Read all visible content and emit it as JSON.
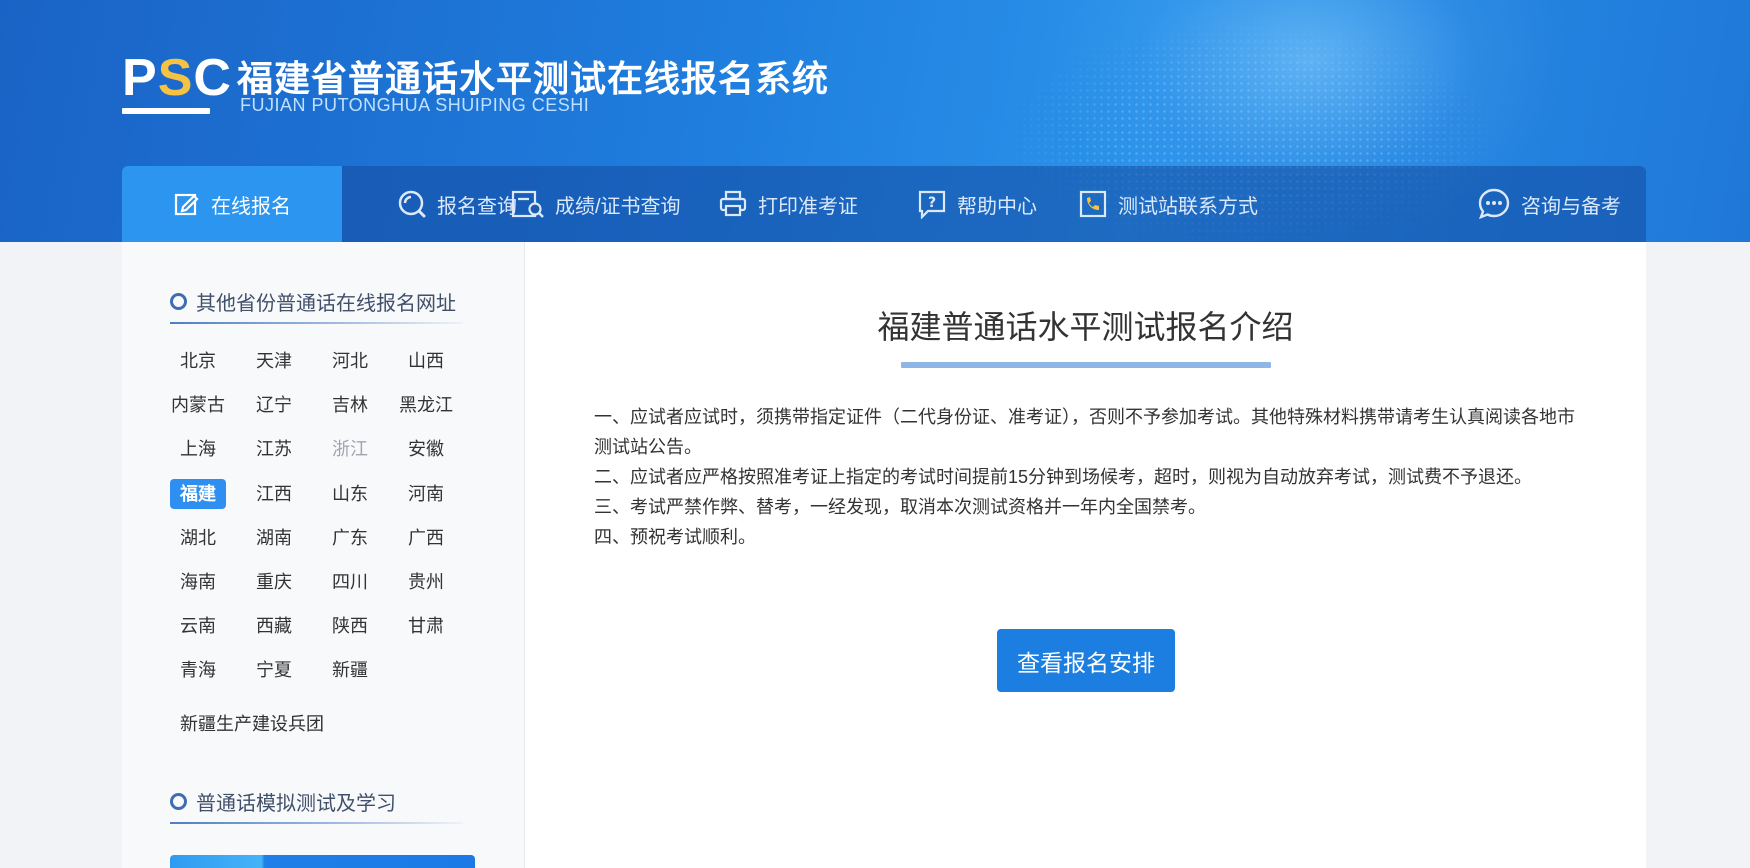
{
  "header": {
    "logo": {
      "p": "P",
      "s": "S",
      "c": "C"
    },
    "title": "福建省普通话水平测试在线报名系统",
    "subtitle": "FUJIAN PUTONGHUA SHUIPING CESHI"
  },
  "nav": {
    "items": [
      {
        "label": "在线报名",
        "icon": "edit-icon",
        "active": true
      },
      {
        "label": "报名查询",
        "icon": "search-icon"
      },
      {
        "label": "成绩/证书查询",
        "icon": "certificate-search-icon"
      },
      {
        "label": "打印准考证",
        "icon": "printer-icon"
      },
      {
        "label": "帮助中心",
        "icon": "help-icon"
      },
      {
        "label": "测试站联系方式",
        "icon": "phone-icon"
      },
      {
        "label": "咨询与备考",
        "icon": "chat-icon"
      }
    ]
  },
  "sidebar": {
    "provinces_title": "其他省份普通话在线报名网址",
    "provinces": [
      "北京",
      "天津",
      "河北",
      "山西",
      "内蒙古",
      "辽宁",
      "吉林",
      "黑龙江",
      "上海",
      "江苏",
      "浙江",
      "安徽",
      "福建",
      "江西",
      "山东",
      "河南",
      "湖北",
      "湖南",
      "广东",
      "广西",
      "海南",
      "重庆",
      "四川",
      "贵州",
      "云南",
      "西藏",
      "陕西",
      "甘肃",
      "青海",
      "宁夏",
      "新疆"
    ],
    "active_province": "福建",
    "disabled_province": "浙江",
    "corps": "新疆生产建设兵团",
    "simulation_title": "普通话模拟测试及学习"
  },
  "main": {
    "title": "福建普通话水平测试报名介绍",
    "rules": [
      "一、应试者应试时，须携带指定证件（二代身份证、准考证），否则不予参加考试。其他特殊材料携带请考生认真阅读各地市测试站公告。",
      "二、应试者应严格按照准考证上指定的考试时间提前15分钟到场候考，超时，则视为自动放弃考试，测试费不予退还。",
      "三、考试严禁作弊、替考，一经发现，取消本次测试资格并一年内全国禁考。",
      "四、预祝考试顺利。"
    ],
    "cta": "查看报名安排"
  },
  "colors": {
    "accent": "#2b95ef",
    "button": "#1b7ee0",
    "logo_s": "#f5c341"
  }
}
